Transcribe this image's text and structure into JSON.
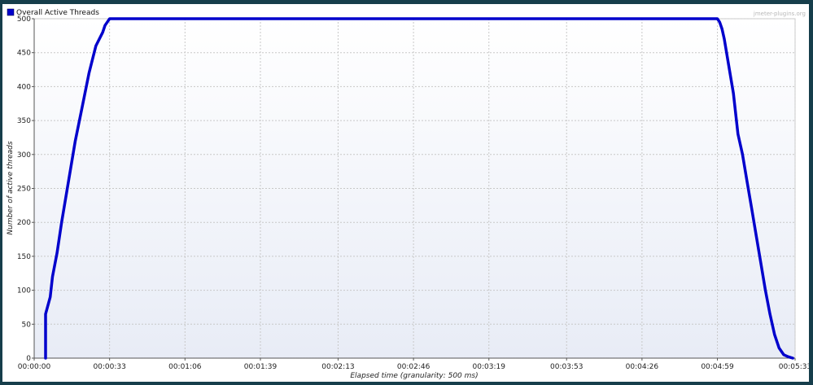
{
  "chart_data": {
    "type": "line",
    "legend": [
      "Overall Active Threads"
    ],
    "legend_position": "top-left",
    "watermark": "jmeter-plugins.org",
    "xlabel": "Elapsed time (granularity: 500 ms)",
    "ylabel": "Number of active threads",
    "xlim": [
      0,
      333
    ],
    "ylim": [
      0,
      500
    ],
    "grid": true,
    "y_ticks": [
      0,
      50,
      100,
      150,
      200,
      250,
      300,
      350,
      400,
      450,
      500
    ],
    "x_ticks": [
      {
        "value": 0,
        "label": "00:00:00"
      },
      {
        "value": 33,
        "label": "00:00:33"
      },
      {
        "value": 66,
        "label": "00:01:06"
      },
      {
        "value": 99,
        "label": "00:01:39"
      },
      {
        "value": 133,
        "label": "00:02:13"
      },
      {
        "value": 166,
        "label": "00:02:46"
      },
      {
        "value": 199,
        "label": "00:03:19"
      },
      {
        "value": 233,
        "label": "00:03:53"
      },
      {
        "value": 266,
        "label": "00:04:26"
      },
      {
        "value": 299,
        "label": "00:04:59"
      },
      {
        "value": 333,
        "label": "00:05:33"
      }
    ],
    "series": [
      {
        "name": "Overall Active Threads",
        "color": "#0000cc",
        "x": [
          5,
          5,
          7,
          8,
          10,
          12,
          15,
          18,
          21,
          24,
          27,
          30,
          31,
          32,
          33,
          60,
          100,
          150,
          200,
          250,
          299,
          300,
          301,
          302,
          303,
          304,
          305,
          306,
          307,
          308,
          310,
          312,
          314,
          316,
          318,
          320,
          322,
          324,
          326,
          328,
          330,
          331,
          332
        ],
        "y": [
          0,
          65,
          90,
          120,
          155,
          200,
          260,
          320,
          370,
          420,
          460,
          480,
          490,
          495,
          500,
          500,
          500,
          500,
          500,
          500,
          500,
          495,
          485,
          470,
          450,
          430,
          410,
          390,
          360,
          330,
          300,
          260,
          220,
          180,
          140,
          100,
          65,
          35,
          15,
          5,
          2,
          1,
          0
        ]
      }
    ]
  }
}
